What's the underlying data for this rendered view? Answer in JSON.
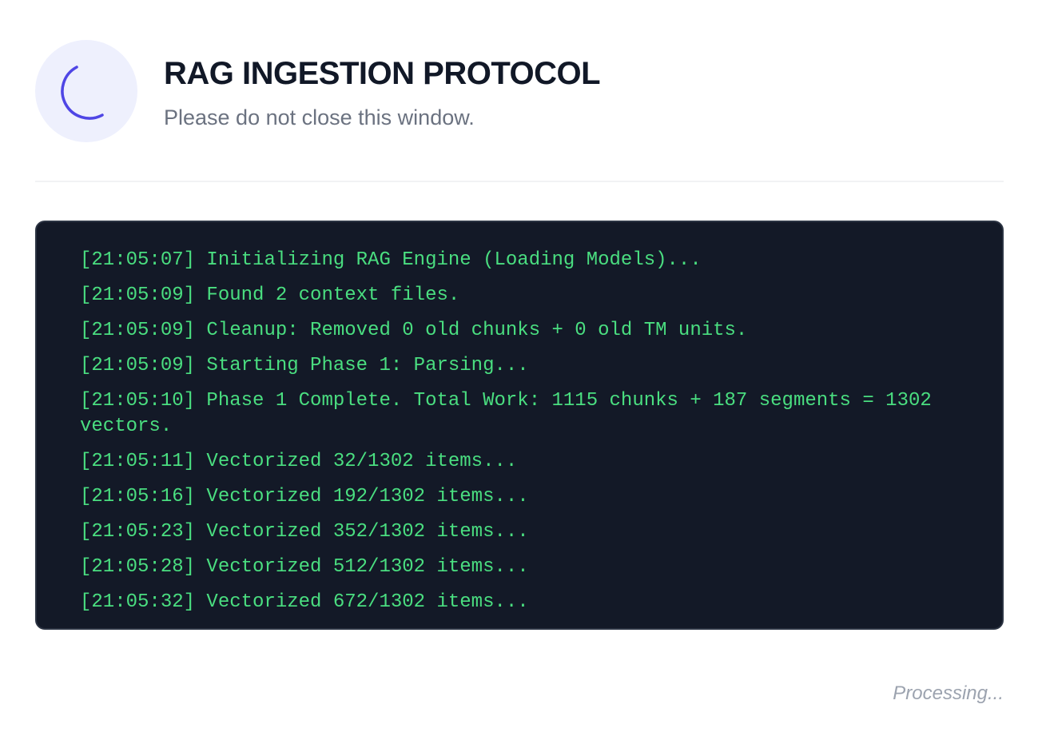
{
  "header": {
    "title": "RAG INGESTION PROTOCOL",
    "subtitle": "Please do not close this window.",
    "spinner_icon": "loading-spinner-icon",
    "accent_color": "#4f46e5",
    "spinner_bg_color": "#eef0fd"
  },
  "terminal": {
    "text_color": "#4ade80",
    "background_color": "#131927",
    "lines": [
      "[21:05:07] Initializing RAG Engine (Loading Models)...",
      "[21:05:09] Found 2 context files.",
      "[21:05:09] Cleanup: Removed 0 old chunks + 0 old TM units.",
      "[21:05:09] Starting Phase 1: Parsing...",
      "[21:05:10] Phase 1 Complete. Total Work: 1115 chunks + 187 segments = 1302 vectors.",
      "[21:05:11] Vectorized 32/1302 items...",
      "[21:05:16] Vectorized 192/1302 items...",
      "[21:05:23] Vectorized 352/1302 items...",
      "[21:05:28] Vectorized 512/1302 items...",
      "[21:05:32] Vectorized 672/1302 items..."
    ]
  },
  "footer": {
    "status": "Processing..."
  }
}
